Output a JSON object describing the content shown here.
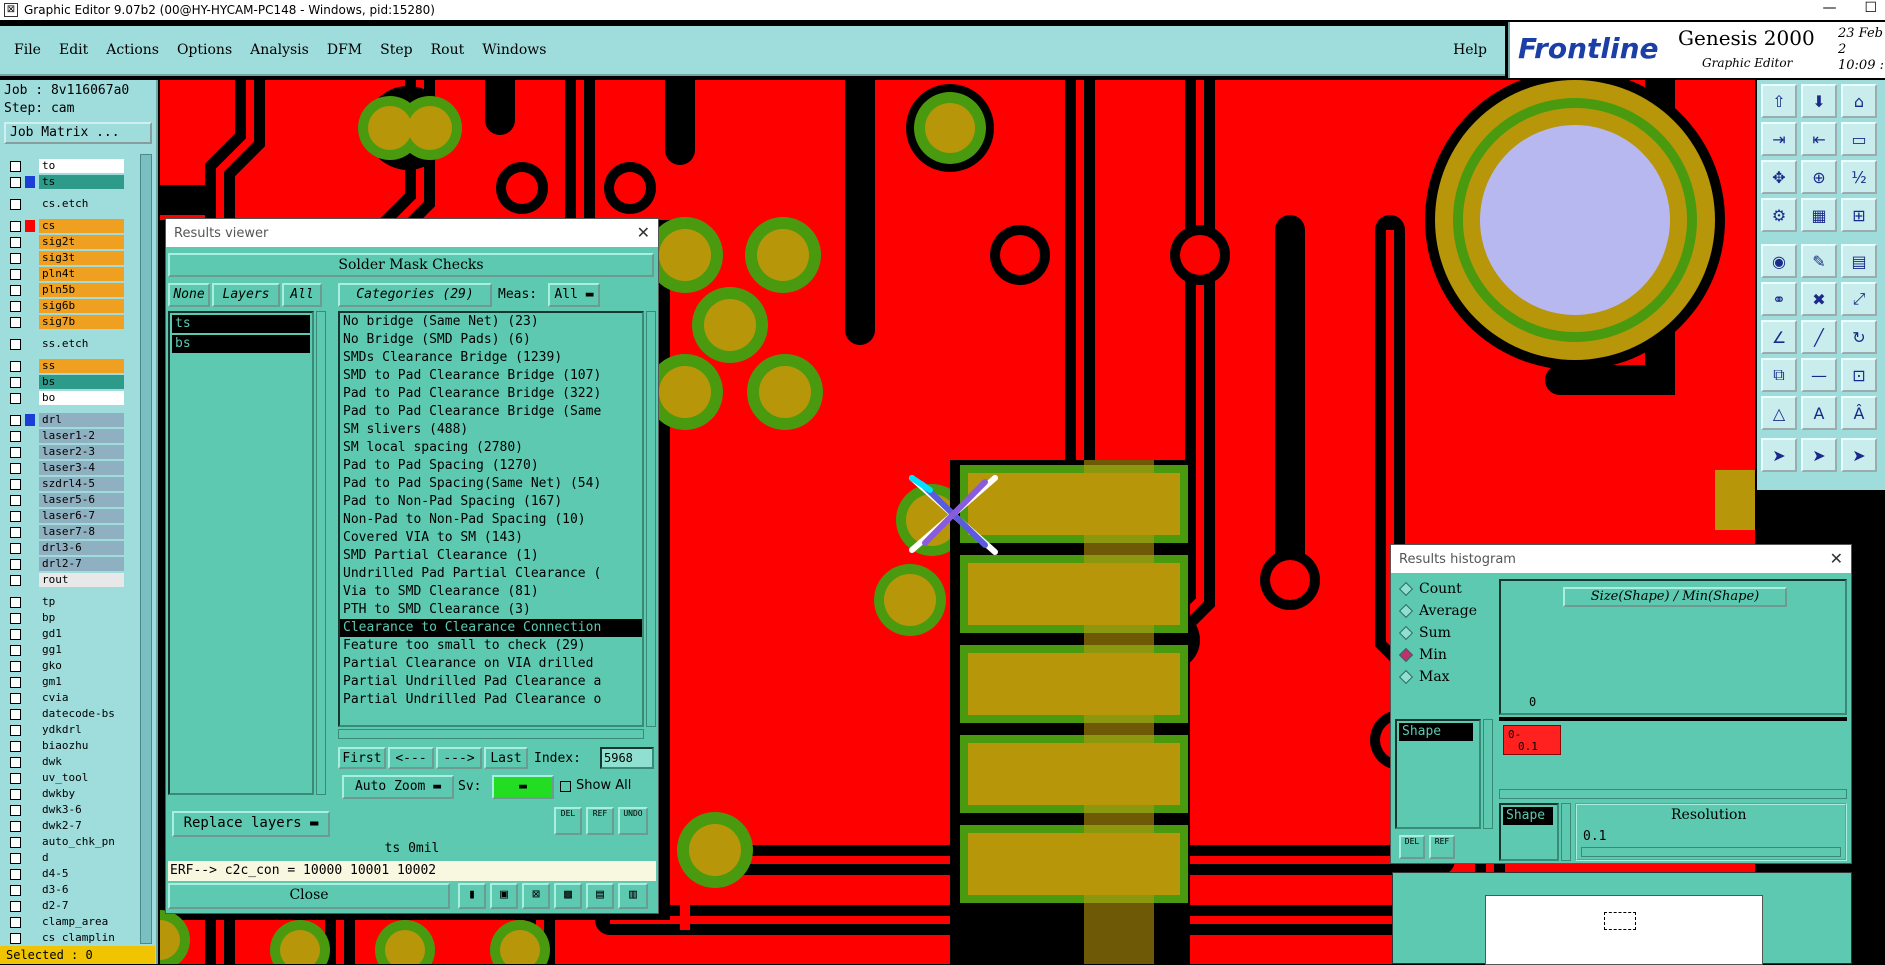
{
  "window": {
    "title": "Graphic Editor 9.07b2 (00@HY-HYCAM-PC148 - Windows, pid:15280)",
    "min": "—",
    "max": "☐"
  },
  "menu": [
    "File",
    "Edit",
    "Actions",
    "Options",
    "Analysis",
    "DFM",
    "Step",
    "Rout",
    "Windows"
  ],
  "help": "Help",
  "brand": {
    "logo": "Frontline",
    "product": "Genesis 2000",
    "subtitle": "Graphic Editor",
    "date_line1": "23 Feb 2",
    "date_line2": "10:09 :"
  },
  "job": {
    "job_line": "Job : 8v116067a0",
    "step_line": "Step: cam",
    "matrix_button": "Job Matrix ..."
  },
  "layers": [
    {
      "name": "to",
      "bg": "#ffffff",
      "sw": "",
      "gap": false
    },
    {
      "name": "ts",
      "bg": "#2e9a8a",
      "sw": "#1b3fd6",
      "gap": false
    },
    {
      "name": "cs.etch",
      "bg": "#9fdcdc",
      "sw": "",
      "gap": true
    },
    {
      "name": "cs",
      "bg": "#f0a020",
      "sw": "#ff0000",
      "gap": true
    },
    {
      "name": "sig2t",
      "bg": "#f0a020",
      "sw": "",
      "gap": false
    },
    {
      "name": "sig3t",
      "bg": "#f0a020",
      "sw": "",
      "gap": false
    },
    {
      "name": "pln4t",
      "bg": "#f0a020",
      "sw": "",
      "gap": false
    },
    {
      "name": "pln5b",
      "bg": "#f0a020",
      "sw": "",
      "gap": false
    },
    {
      "name": "sig6b",
      "bg": "#f0a020",
      "sw": "",
      "gap": false
    },
    {
      "name": "sig7b",
      "bg": "#f0a020",
      "sw": "",
      "gap": false
    },
    {
      "name": "ss.etch",
      "bg": "#9fdcdc",
      "sw": "",
      "gap": true
    },
    {
      "name": "ss",
      "bg": "#f0a020",
      "sw": "",
      "gap": true
    },
    {
      "name": "bs",
      "bg": "#2e9a8a",
      "sw": "",
      "gap": false
    },
    {
      "name": "bo",
      "bg": "#ffffff",
      "sw": "",
      "gap": false
    },
    {
      "name": "drl",
      "bg": "#8fb0c0",
      "sw": "#1b3fd6",
      "gap": true
    },
    {
      "name": "laser1-2",
      "bg": "#8fb0c0",
      "sw": "",
      "gap": false
    },
    {
      "name": "laser2-3",
      "bg": "#8fb0c0",
      "sw": "",
      "gap": false
    },
    {
      "name": "laser3-4",
      "bg": "#8fb0c0",
      "sw": "",
      "gap": false
    },
    {
      "name": "szdrl4-5",
      "bg": "#8fb0c0",
      "sw": "",
      "gap": false
    },
    {
      "name": "laser5-6",
      "bg": "#8fb0c0",
      "sw": "",
      "gap": false
    },
    {
      "name": "laser6-7",
      "bg": "#8fb0c0",
      "sw": "",
      "gap": false
    },
    {
      "name": "laser7-8",
      "bg": "#8fb0c0",
      "sw": "",
      "gap": false
    },
    {
      "name": "drl3-6",
      "bg": "#8fb0c0",
      "sw": "",
      "gap": false
    },
    {
      "name": "drl2-7",
      "bg": "#8fb0c0",
      "sw": "",
      "gap": false
    },
    {
      "name": "rout",
      "bg": "#e8e8e8",
      "sw": "",
      "gap": false
    },
    {
      "name": "tp",
      "bg": "#9fdcdc",
      "sw": "",
      "gap": true
    },
    {
      "name": "bp",
      "bg": "#9fdcdc",
      "sw": "",
      "gap": false
    },
    {
      "name": "gd1",
      "bg": "#9fdcdc",
      "sw": "",
      "gap": false
    },
    {
      "name": "gg1",
      "bg": "#9fdcdc",
      "sw": "",
      "gap": false
    },
    {
      "name": "gko",
      "bg": "#9fdcdc",
      "sw": "",
      "gap": false
    },
    {
      "name": "gm1",
      "bg": "#9fdcdc",
      "sw": "",
      "gap": false
    },
    {
      "name": "cvia",
      "bg": "#9fdcdc",
      "sw": "",
      "gap": false
    },
    {
      "name": "datecode-bs",
      "bg": "#9fdcdc",
      "sw": "",
      "gap": false
    },
    {
      "name": "ydkdrl",
      "bg": "#9fdcdc",
      "sw": "",
      "gap": false
    },
    {
      "name": "biaozhu",
      "bg": "#9fdcdc",
      "sw": "",
      "gap": false
    },
    {
      "name": "dwk",
      "bg": "#9fdcdc",
      "sw": "",
      "gap": false
    },
    {
      "name": "uv_tool",
      "bg": "#9fdcdc",
      "sw": "",
      "gap": false
    },
    {
      "name": "dwkby",
      "bg": "#9fdcdc",
      "sw": "",
      "gap": false
    },
    {
      "name": "dwk3-6",
      "bg": "#9fdcdc",
      "sw": "",
      "gap": false
    },
    {
      "name": "dwk2-7",
      "bg": "#9fdcdc",
      "sw": "",
      "gap": false
    },
    {
      "name": "auto_chk_pn",
      "bg": "#9fdcdc",
      "sw": "",
      "gap": false
    },
    {
      "name": "d",
      "bg": "#9fdcdc",
      "sw": "",
      "gap": false
    },
    {
      "name": "d4-5",
      "bg": "#9fdcdc",
      "sw": "",
      "gap": false
    },
    {
      "name": "d3-6",
      "bg": "#9fdcdc",
      "sw": "",
      "gap": false
    },
    {
      "name": "d2-7",
      "bg": "#9fdcdc",
      "sw": "",
      "gap": false
    },
    {
      "name": "clamp_area",
      "bg": "#9fdcdc",
      "sw": "",
      "gap": false
    },
    {
      "name": "cs clamplin",
      "bg": "#9fdcdc",
      "sw": "",
      "gap": false
    }
  ],
  "selected": "Selected : 0",
  "results_viewer": {
    "title": "Results viewer",
    "banner": "Solder Mask Checks",
    "none_btn": "None",
    "layers_btn": "Layers",
    "all_btn": "All",
    "layer_items": [
      "ts",
      "bs"
    ],
    "categories_btn": "Categories (29)",
    "meas_label": "Meas:",
    "meas_value": "All",
    "categories": [
      "No bridge (Same Net) (23)",
      "No Bridge (SMD Pads) (6)",
      "SMDs Clearance Bridge (1239)",
      "SMD to Pad Clearance Bridge (107)",
      "Pad to Pad Clearance Bridge (322)",
      "Pad to Pad Clearance Bridge (Same",
      "SM slivers (488)",
      "SM local spacing (2780)",
      "Pad to Pad Spacing (1270)",
      "Pad to Pad Spacing(Same Net) (54)",
      "Pad to Non-Pad Spacing (167)",
      "Non-Pad to Non-Pad Spacing (10)",
      "Covered VIA to SM (143)",
      "SMD Partial Clearance (1)",
      "Undrilled Pad Partial Clearance (",
      "Via to SMD Clearance (81)",
      "PTH to SMD Clearance (3)",
      "Clearance to Clearance Connection",
      "Feature too small to check (29)",
      "Partial Clearance on VIA drilled",
      "Partial Undrilled Pad Clearance a",
      "Partial Undrilled Pad Clearance o"
    ],
    "selected_index": 17,
    "first_btn": "First",
    "prev_btn": "<---",
    "next_btn": "--->",
    "last_btn": "Last",
    "index_label": "Index:",
    "index_value": "5968",
    "autozoom": "Auto Zoom",
    "sv_label": "Sv:",
    "show_all": "Show All",
    "replace_layers": "Replace layers",
    "del": "DEL",
    "ref": "REF",
    "undo": "UNDO",
    "status": "ts 0mil",
    "erf": "ERF--> c2c_con = 10000 10001 10002",
    "close": "Close"
  },
  "histogram": {
    "title": "Results histogram",
    "options": [
      "Count",
      "Average",
      "Sum",
      "Min",
      "Max"
    ],
    "selected_option": 3,
    "measure_btn": "Size(Shape) / Min(Shape)",
    "list_item": "Shape",
    "axis_zero": "0",
    "bin_label": "0-",
    "bin_label2": "0.1",
    "shape_label": "Shape",
    "resolution_label": "Resolution",
    "resolution_value": "0.1",
    "del": "DEL",
    "ref": "REF"
  },
  "colors": {
    "panel": "#9fdcdc",
    "window": "#5cc9b0",
    "copper": "#ff0000",
    "pad": "#b8960a",
    "ring": "#4a9a10"
  }
}
